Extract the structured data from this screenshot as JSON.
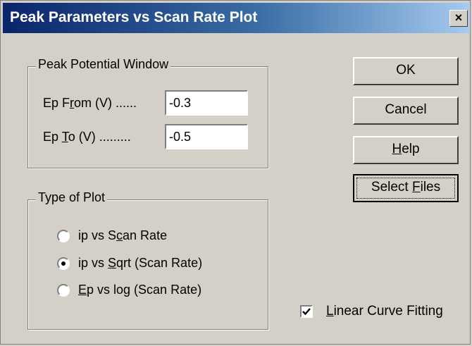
{
  "window": {
    "title": "Peak Parameters vs Scan Rate Plot",
    "close_label": "×"
  },
  "peak_window": {
    "label": "Peak Potential Window",
    "from_label_pre": "Ep F",
    "from_label_ul": "r",
    "from_label_post": "om (V) ......",
    "from_value": "-0.3",
    "to_label_pre": "Ep ",
    "to_label_ul": "T",
    "to_label_post": "o (V) .........",
    "to_value": "-0.5"
  },
  "buttons": {
    "ok": "OK",
    "cancel": "Cancel",
    "help_ul": "H",
    "help_rest": "elp",
    "select_pre": "Select ",
    "select_ul": "F",
    "select_post": "iles"
  },
  "plot_type": {
    "label": "Type of Plot",
    "options": [
      {
        "pre": "ip vs S",
        "ul": "c",
        "post": "an Rate",
        "selected": false
      },
      {
        "pre": "ip vs ",
        "ul": "S",
        "post": "qrt (Scan Rate)",
        "selected": true
      },
      {
        "pre": "",
        "ul": "E",
        "post": "p vs log (Scan Rate)",
        "selected": false
      }
    ]
  },
  "linear_fit": {
    "pre": "",
    "ul": "L",
    "post": "inear Curve Fitting",
    "checked": true
  }
}
